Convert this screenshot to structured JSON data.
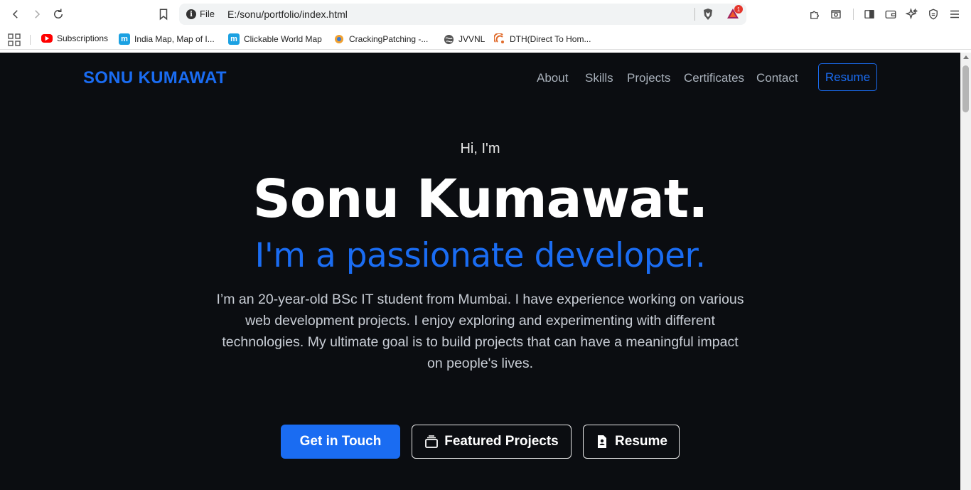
{
  "browser": {
    "address_scheme": "File",
    "url": "E:/sonu/portfolio/index.html",
    "notification_count": "1",
    "bookmarks": [
      {
        "label": "Subscriptions",
        "icon": "youtube-icon",
        "color": "#ff0000"
      },
      {
        "label": "India Map, Map of I...",
        "icon": "m-icon",
        "color": "#1ba1e2"
      },
      {
        "label": "Clickable World Map",
        "icon": "m-icon",
        "color": "#1ba1e2"
      },
      {
        "label": "CrackingPatching -...",
        "icon": "crackingpatching-icon",
        "color": "#f0a030"
      },
      {
        "label": "JVVNL",
        "icon": "globe-icon",
        "color": "#555555"
      },
      {
        "label": "DTH(Direct To Hom...",
        "icon": "dth-icon",
        "color": "#e06a2a"
      }
    ]
  },
  "site": {
    "brand": "SONU KUMAWAT",
    "nav": [
      "About",
      "Skills",
      "Projects",
      "Certificates",
      "Contact"
    ],
    "resume_nav": "Resume",
    "accent": "#1a6cf2",
    "background": "#0b0d11"
  },
  "hero": {
    "greeting": "Hi, I'm",
    "name": "Sonu Kumawat.",
    "tagline": "I'm a passionate developer.",
    "bio": "I’m an 20-year-old BSc IT student from Mumbai. I have experience working on various web development projects. I enjoy exploring and experimenting with different technologies. My ultimate goal is to build projects that can have a meaningful impact on people's lives.",
    "buttons": {
      "contact": "Get in Touch",
      "projects": "Featured Projects",
      "resume": "Resume"
    }
  }
}
